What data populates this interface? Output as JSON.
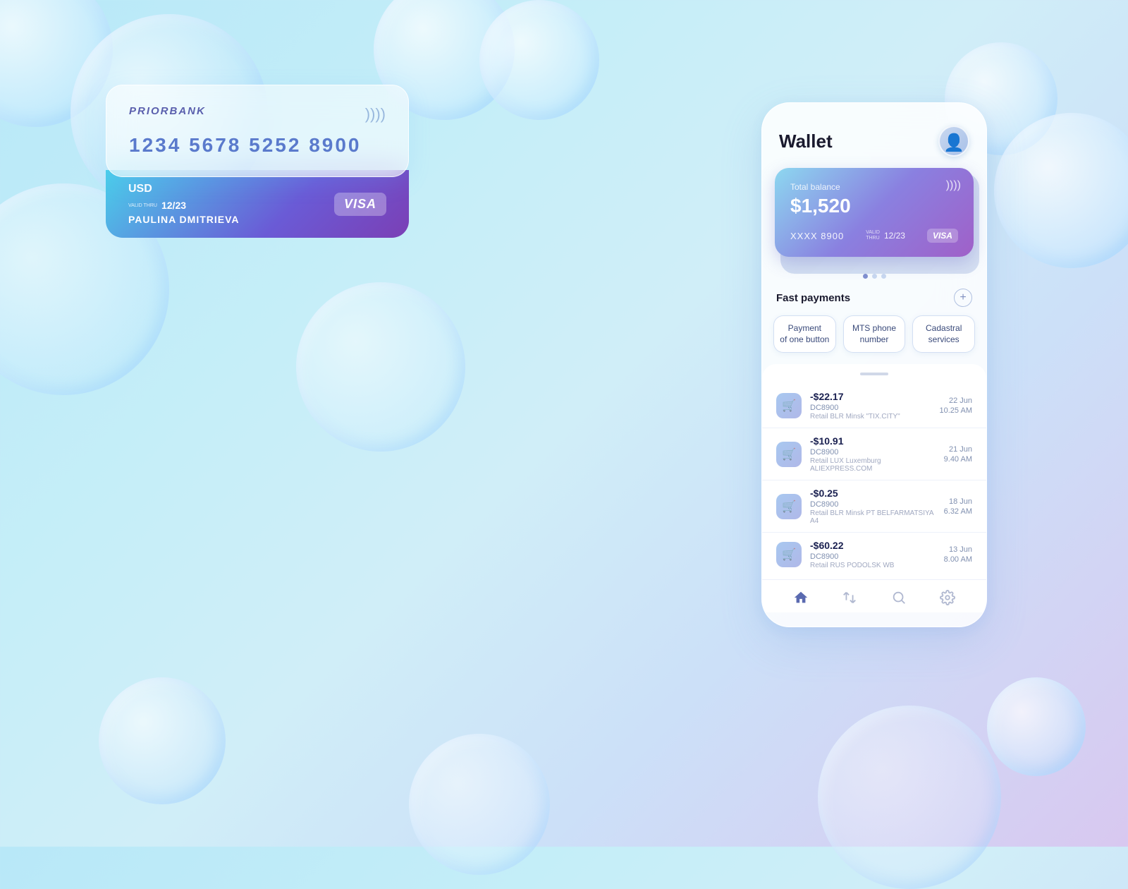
{
  "background": {
    "gradient_start": "#b8e8f8",
    "gradient_end": "#d8c8f0"
  },
  "large_card": {
    "bank_name": "PRIORBANK",
    "card_number": "1234 5678 5252 8900",
    "currency": "USD",
    "valid_thru_label": "VALID THRU",
    "expiry": "12/23",
    "cardholder": "PAULINA DMITRIEVA",
    "card_brand": "VISA"
  },
  "wallet_app": {
    "title": "Wallet",
    "total_balance_label": "Total balance",
    "total_balance": "$1,520",
    "card_number_masked": "XXXX  8900",
    "card_valid_label": "VALID",
    "card_expiry": "12/23",
    "card_brand": "VISA",
    "add_button_label": "+",
    "fast_payments_title": "Fast payments",
    "fast_payment_buttons": [
      {
        "label": "Payment\nof one button"
      },
      {
        "label": "MTS phone\nnumber"
      },
      {
        "label": "Cadastral\nservices"
      }
    ],
    "transactions": [
      {
        "amount": "-$22.17",
        "code": "DC8900",
        "desc": "Retail BLR Minsk \"TIX.CITY\"",
        "date": "22 Jun",
        "time": "10.25 AM"
      },
      {
        "amount": "-$10.91",
        "code": "DC8900",
        "desc": "Retail LUX Luxemburg ALIEXPRESS.COM",
        "date": "21 Jun",
        "time": "9.40 AM"
      },
      {
        "amount": "-$0.25",
        "code": "DC8900",
        "desc": "Retail BLR Minsk PT BELFARMATSIYA A4",
        "date": "18 Jun",
        "time": "6.32 AM"
      },
      {
        "amount": "-$60.22",
        "code": "DC8900",
        "desc": "Retail RUS PODOLSK WB",
        "date": "13 Jun",
        "time": "8.00 AM"
      }
    ],
    "nav_items": [
      "home",
      "transfer",
      "search",
      "settings"
    ]
  }
}
